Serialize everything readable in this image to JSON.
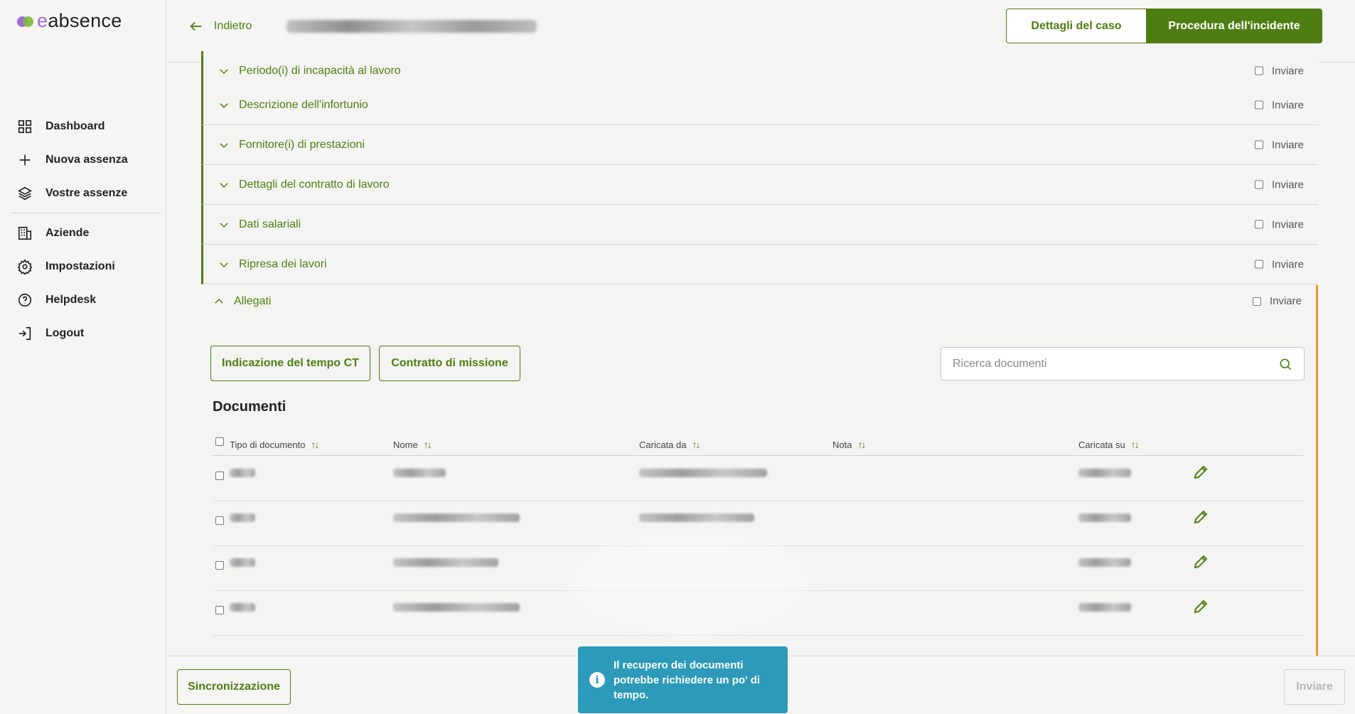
{
  "app": {
    "logo_e": "e",
    "logo_rest": "absence"
  },
  "sidebar": {
    "items": [
      {
        "label": "Dashboard",
        "icon": "dashboard-icon"
      },
      {
        "label": "Nuova assenza",
        "icon": "plus-icon"
      },
      {
        "label": "Vostre assenze",
        "icon": "layers-icon"
      },
      {
        "label": "Aziende",
        "icon": "building-icon"
      },
      {
        "label": "Impostazioni",
        "icon": "gear-icon"
      },
      {
        "label": "Helpdesk",
        "icon": "help-circle-icon"
      },
      {
        "label": "Logout",
        "icon": "logout-icon"
      }
    ]
  },
  "header": {
    "back_label": "Indietro",
    "tab_case": "Dettagli del caso",
    "tab_incident": "Procedura dell'incidente"
  },
  "sections": [
    {
      "title": "Periodo(i) di incapacità al lavoro",
      "send": "Inviare"
    },
    {
      "title": "Descrizione dell'infortunio",
      "send": "Inviare"
    },
    {
      "title": "Fornitore(i) di prestazioni",
      "send": "Inviare"
    },
    {
      "title": "Dettagli del contratto di lavoro",
      "send": "Inviare"
    },
    {
      "title": "Dati salariali",
      "send": "Inviare"
    },
    {
      "title": "Ripresa dei lavori",
      "send": "Inviare"
    }
  ],
  "attachments": {
    "title": "Allegati",
    "send": "Inviare",
    "button_ct": "Indicazione del tempo CT",
    "button_mission": "Contratto di missione",
    "search_placeholder": "Ricerca documenti",
    "documents_title": "Documenti",
    "columns": [
      "Tipo di documento",
      "Nome",
      "Caricata da",
      "Nota",
      "Caricata su"
    ]
  },
  "footer": {
    "sync_label": "Sincronizzazione",
    "send_label": "Inviare"
  },
  "toast": {
    "message": "Il recupero dei documenti potrebbe richiedere un po' di tempo."
  },
  "colors": {
    "accent": "#4e7e12",
    "toast": "#2c9ab8",
    "highlight": "#e39a2c"
  }
}
